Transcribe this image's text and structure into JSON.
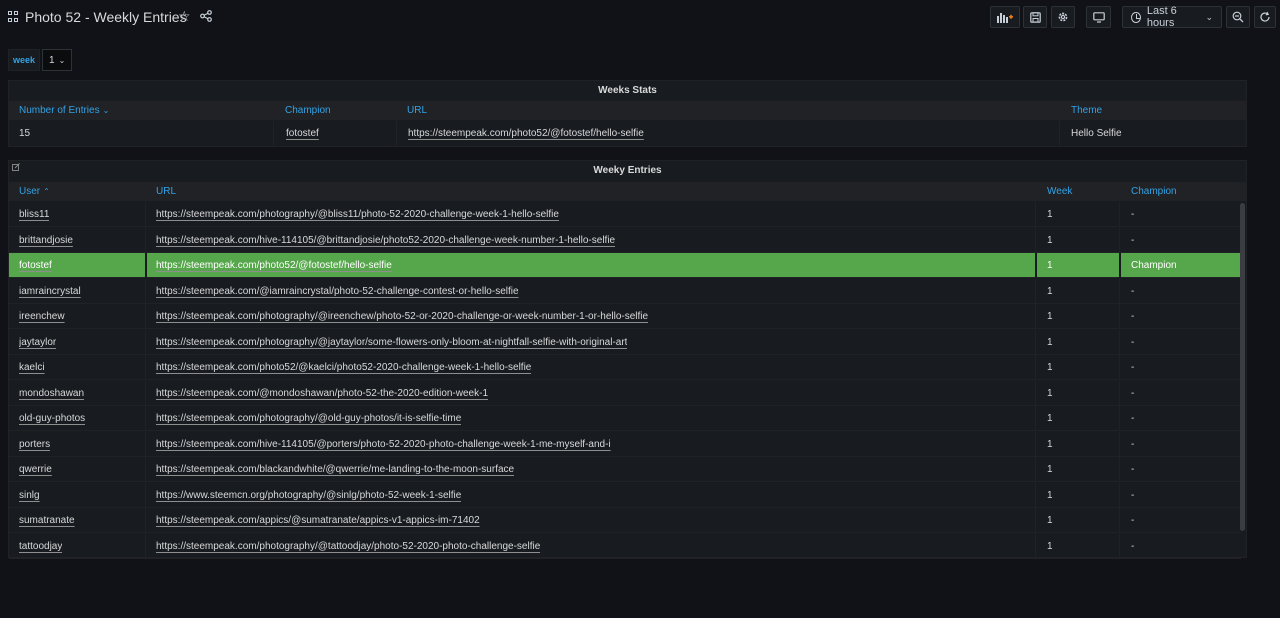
{
  "header": {
    "title": "Photo 52 - Weekly Entries",
    "time_range": "Last 6 hours"
  },
  "variable": {
    "label": "week",
    "value": "1"
  },
  "stats_panel": {
    "title": "Weeks Stats",
    "columns": [
      "Number of Entries",
      "Champion",
      "URL",
      "Theme"
    ],
    "row": {
      "entries": "15",
      "champion": "fotostef",
      "url": "https://steempeak.com/photo52/@fotostef/hello-selfie",
      "theme": "Hello Selfie"
    }
  },
  "entries_panel": {
    "title": "Weeky Entries",
    "columns": [
      "User",
      "URL",
      "Week",
      "Champion"
    ],
    "rows": [
      {
        "user": "bliss11",
        "url": "https://steempeak.com/photography/@bliss11/photo-52-2020-challenge-week-1-hello-selfie",
        "week": "1",
        "champion": "-"
      },
      {
        "user": "brittandjosie",
        "url": "https://steempeak.com/hive-114105/@brittandjosie/photo52-2020-challenge-week-number-1-hello-selfie",
        "week": "1",
        "champion": "-"
      },
      {
        "user": "fotostef",
        "url": "https://steempeak.com/photo52/@fotostef/hello-selfie",
        "week": "1",
        "champion": "Champion",
        "highlight": true
      },
      {
        "user": "iamraincrystal",
        "url": "https://steempeak.com/@iamraincrystal/photo-52-challenge-contest-or-hello-selfie",
        "week": "1",
        "champion": "-"
      },
      {
        "user": "ireenchew",
        "url": "https://steempeak.com/photography/@ireenchew/photo-52-or-2020-challenge-or-week-number-1-or-hello-selfie",
        "week": "1",
        "champion": "-"
      },
      {
        "user": "jaytaylor",
        "url": "https://steempeak.com/photography/@jaytaylor/some-flowers-only-bloom-at-nightfall-selfie-with-original-art",
        "week": "1",
        "champion": "-"
      },
      {
        "user": "kaelci",
        "url": "https://steempeak.com/photo52/@kaelci/photo52-2020-challenge-week-1-hello-selfie",
        "week": "1",
        "champion": "-"
      },
      {
        "user": "mondoshawan",
        "url": "https://steempeak.com/@mondoshawan/photo-52-the-2020-edition-week-1",
        "week": "1",
        "champion": "-"
      },
      {
        "user": "old-guy-photos",
        "url": "https://steempeak.com/photography/@old-guy-photos/it-is-selfie-time",
        "week": "1",
        "champion": "-"
      },
      {
        "user": "porters",
        "url": "https://steempeak.com/hive-114105/@porters/photo-52-2020-photo-challenge-week-1-me-myself-and-i",
        "week": "1",
        "champion": "-"
      },
      {
        "user": "qwerrie",
        "url": "https://steempeak.com/blackandwhite/@qwerrie/me-landing-to-the-moon-surface",
        "week": "1",
        "champion": "-"
      },
      {
        "user": "sinlg",
        "url": "https://www.steemcn.org/photography/@sinlg/photo-52-week-1-selfie",
        "week": "1",
        "champion": "-"
      },
      {
        "user": "sumatranate",
        "url": "https://steempeak.com/appics/@sumatranate/appics-v1-appics-im-71402",
        "week": "1",
        "champion": "-"
      },
      {
        "user": "tattoodjay",
        "url": "https://steempeak.com/photography/@tattoodjay/photo-52-2020-photo-challenge-selfie",
        "week": "1",
        "champion": "-"
      }
    ]
  },
  "colors": {
    "background": "#111217",
    "panel": "#181b1f",
    "header_text": "#33a2e5",
    "highlight_row": "#56a64b"
  }
}
